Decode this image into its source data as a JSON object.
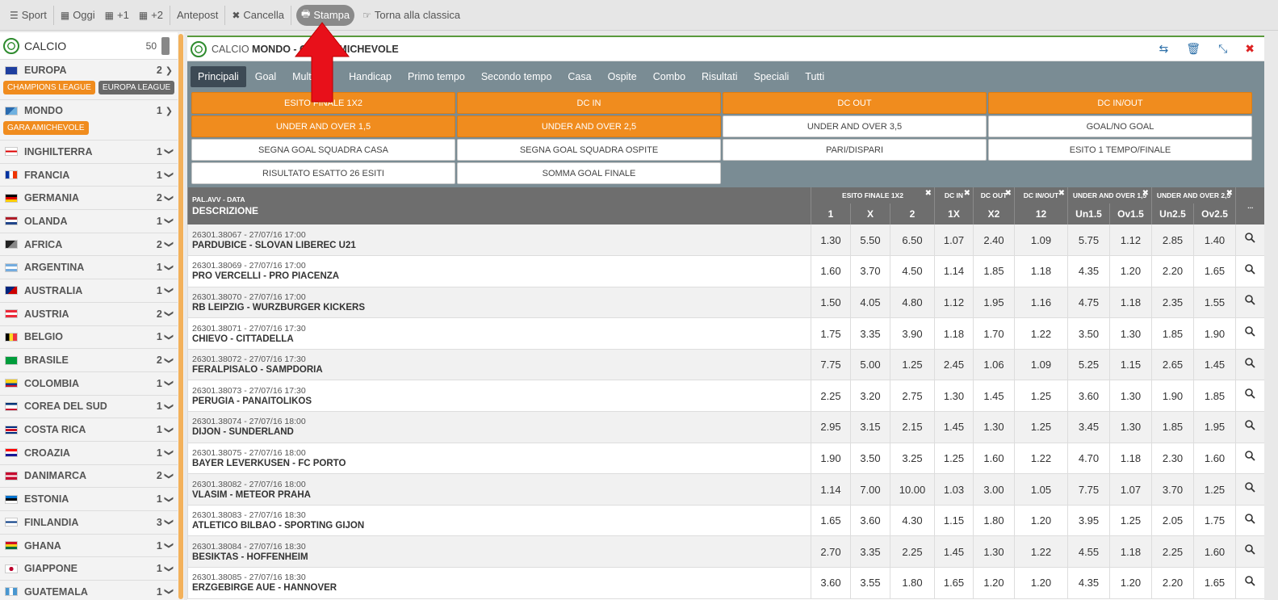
{
  "toolbar": {
    "items": [
      {
        "icon": "hamburger-icon",
        "label": "Sport"
      },
      {
        "icon": "calendar-icon",
        "label": "Oggi"
      },
      {
        "icon": "calendar-icon",
        "label": "+1"
      },
      {
        "icon": "calendar-icon",
        "label": "+2"
      },
      {
        "icon": "",
        "label": "Antepost"
      },
      {
        "icon": "cross-icon",
        "label": "Cancella"
      },
      {
        "icon": "print-icon",
        "label": "Stampa"
      },
      {
        "icon": "hand-point-icon",
        "label": "Torna alla classica"
      }
    ]
  },
  "sidebar": {
    "title": "CALCIO",
    "count": "50",
    "europa": {
      "name": "EUROPA",
      "count": "2",
      "tags": [
        "CHAMPIONS LEAGUE",
        "EUROPA LEAGUE"
      ]
    },
    "mondo": {
      "name": "MONDO",
      "count": "1",
      "tags": [
        "GARA AMICHEVOLE"
      ]
    },
    "countries": [
      {
        "name": "INGHILTERRA",
        "count": "1"
      },
      {
        "name": "FRANCIA",
        "count": "1"
      },
      {
        "name": "GERMANIA",
        "count": "2"
      },
      {
        "name": "OLANDA",
        "count": "1"
      },
      {
        "name": "AFRICA",
        "count": "2"
      },
      {
        "name": "ARGENTINA",
        "count": "1"
      },
      {
        "name": "AUSTRALIA",
        "count": "1"
      },
      {
        "name": "AUSTRIA",
        "count": "2"
      },
      {
        "name": "BELGIO",
        "count": "1"
      },
      {
        "name": "BRASILE",
        "count": "2"
      },
      {
        "name": "COLOMBIA",
        "count": "1"
      },
      {
        "name": "COREA DEL SUD",
        "count": "1"
      },
      {
        "name": "COSTA RICA",
        "count": "1"
      },
      {
        "name": "CROAZIA",
        "count": "1"
      },
      {
        "name": "DANIMARCA",
        "count": "2"
      },
      {
        "name": "ESTONIA",
        "count": "1"
      },
      {
        "name": "FINLANDIA",
        "count": "3"
      },
      {
        "name": "GHANA",
        "count": "1"
      },
      {
        "name": "GIAPPONE",
        "count": "1"
      },
      {
        "name": "GUATEMALA",
        "count": "1"
      }
    ]
  },
  "main": {
    "title_prefix": "CALCIO",
    "title_bold": "MONDO - GARA AMICHEVOLE",
    "tabs": [
      "Principali",
      "Goal",
      "Multigoal",
      "Handicap",
      "Primo tempo",
      "Secondo tempo",
      "Casa",
      "Ospite",
      "Combo",
      "Risultati",
      "Speciali",
      "Tutti"
    ],
    "markets": [
      {
        "label": "ESITO FINALE 1X2",
        "on": true
      },
      {
        "label": "DC IN",
        "on": true
      },
      {
        "label": "DC OUT",
        "on": true
      },
      {
        "label": "DC IN/OUT",
        "on": true
      },
      {
        "label": "UNDER AND OVER 1,5",
        "on": true
      },
      {
        "label": "UNDER AND OVER 2,5",
        "on": true
      },
      {
        "label": "UNDER AND OVER 3,5",
        "on": false
      },
      {
        "label": "GOAL/NO GOAL",
        "on": false
      },
      {
        "label": "SEGNA GOAL SQUADRA CASA",
        "on": false
      },
      {
        "label": "SEGNA GOAL SQUADRA OSPITE",
        "on": false
      },
      {
        "label": "PARI/DISPARI",
        "on": false
      },
      {
        "label": "ESITO 1 TEMPO/FINALE",
        "on": false
      },
      {
        "label": "RISULTATO ESATTO 26 ESITI",
        "on": false
      },
      {
        "label": "SOMMA GOAL FINALE",
        "on": false
      }
    ]
  },
  "table": {
    "desc_sub": "PAL.AVV - DATA",
    "desc_main": "DESCRIZIONE",
    "groups": [
      "ESITO FINALE 1X2",
      "DC IN",
      "DC OUT",
      "DC IN/OUT",
      "UNDER AND OVER 1,5",
      "UNDER AND OVER 2,5"
    ],
    "group_close": "✖",
    "more": "...",
    "cols": [
      "1",
      "X",
      "2",
      "1X",
      "X2",
      "12",
      "Un1.5",
      "Ov1.5",
      "Un2.5",
      "Ov2.5"
    ],
    "rows": [
      {
        "code": "26301.38067 - 27/07/16 17:00",
        "event": "PARDUBICE - SLOVAN LIBEREC U21",
        "odds": [
          "1.30",
          "5.50",
          "6.50",
          "1.07",
          "2.40",
          "1.09",
          "5.75",
          "1.12",
          "2.85",
          "1.40"
        ]
      },
      {
        "code": "26301.38069 - 27/07/16 17:00",
        "event": "PRO VERCELLI - PRO PIACENZA",
        "odds": [
          "1.60",
          "3.70",
          "4.50",
          "1.14",
          "1.85",
          "1.18",
          "4.35",
          "1.20",
          "2.20",
          "1.65"
        ]
      },
      {
        "code": "26301.38070 - 27/07/16 17:00",
        "event": "RB LEIPZIG - WURZBURGER KICKERS",
        "odds": [
          "1.50",
          "4.05",
          "4.80",
          "1.12",
          "1.95",
          "1.16",
          "4.75",
          "1.18",
          "2.35",
          "1.55"
        ]
      },
      {
        "code": "26301.38071 - 27/07/16 17:30",
        "event": "CHIEVO - CITTADELLA",
        "odds": [
          "1.75",
          "3.35",
          "3.90",
          "1.18",
          "1.70",
          "1.22",
          "3.50",
          "1.30",
          "1.85",
          "1.90"
        ]
      },
      {
        "code": "26301.38072 - 27/07/16 17:30",
        "event": "FERALPISALO - SAMPDORIA",
        "odds": [
          "7.75",
          "5.00",
          "1.25",
          "2.45",
          "1.06",
          "1.09",
          "5.25",
          "1.15",
          "2.65",
          "1.45"
        ]
      },
      {
        "code": "26301.38073 - 27/07/16 17:30",
        "event": "PERUGIA - PANAITOLIKOS",
        "odds": [
          "2.25",
          "3.20",
          "2.75",
          "1.30",
          "1.45",
          "1.25",
          "3.60",
          "1.30",
          "1.90",
          "1.85"
        ]
      },
      {
        "code": "26301.38074 - 27/07/16 18:00",
        "event": "DIJON - SUNDERLAND",
        "odds": [
          "2.95",
          "3.15",
          "2.15",
          "1.45",
          "1.30",
          "1.25",
          "3.45",
          "1.30",
          "1.85",
          "1.95"
        ]
      },
      {
        "code": "26301.38075 - 27/07/16 18:00",
        "event": "BAYER LEVERKUSEN - FC PORTO",
        "odds": [
          "1.90",
          "3.50",
          "3.25",
          "1.25",
          "1.60",
          "1.22",
          "4.70",
          "1.18",
          "2.30",
          "1.60"
        ]
      },
      {
        "code": "26301.38082 - 27/07/16 18:00",
        "event": "VLASIM - METEOR PRAHA",
        "odds": [
          "1.14",
          "7.00",
          "10.00",
          "1.03",
          "3.00",
          "1.05",
          "7.75",
          "1.07",
          "3.70",
          "1.25"
        ]
      },
      {
        "code": "26301.38083 - 27/07/16 18:30",
        "event": "ATLETICO BILBAO - SPORTING GIJON",
        "odds": [
          "1.65",
          "3.60",
          "4.30",
          "1.15",
          "1.80",
          "1.20",
          "3.95",
          "1.25",
          "2.05",
          "1.75"
        ]
      },
      {
        "code": "26301.38084 - 27/07/16 18:30",
        "event": "BESIKTAS - HOFFENHEIM",
        "odds": [
          "2.70",
          "3.35",
          "2.25",
          "1.45",
          "1.30",
          "1.22",
          "4.55",
          "1.18",
          "2.25",
          "1.60"
        ]
      },
      {
        "code": "26301.38085 - 27/07/16 18:30",
        "event": "ERZGEBIRGE AUE - HANNOVER",
        "odds": [
          "3.60",
          "3.55",
          "1.80",
          "1.65",
          "1.20",
          "1.20",
          "4.35",
          "1.20",
          "2.20",
          "1.65"
        ]
      }
    ]
  },
  "colors": {
    "accent": "#f08c1e",
    "header": "#6e6e6e",
    "tabbar": "#7a8c94",
    "arrow": "#e8101a"
  }
}
